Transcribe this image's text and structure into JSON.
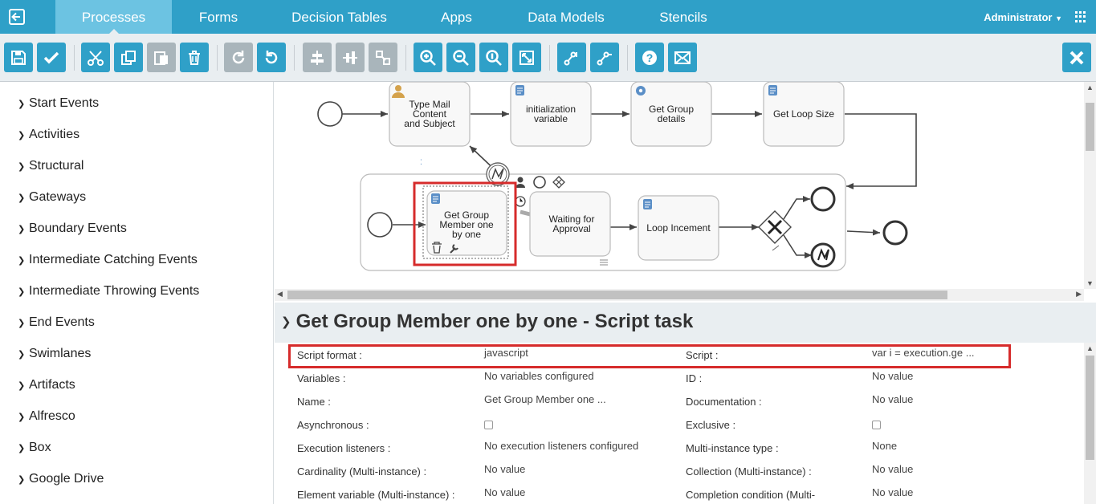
{
  "nav": {
    "tabs": [
      "Processes",
      "Forms",
      "Decision Tables",
      "Apps",
      "Data Models",
      "Stencils"
    ],
    "user": "Administrator"
  },
  "toolbar": {
    "icons": [
      "save-icon",
      "check-icon",
      "cut-icon",
      "copy-icon",
      "paste-icon",
      "delete-icon",
      "redo-icon",
      "undo-icon",
      "align-horizontal-icon",
      "align-vertical-icon",
      "same-size-icon",
      "zoom-in-icon",
      "zoom-out-icon",
      "zoom-actual-icon",
      "zoom-fit-icon",
      "add-bendpoint-icon",
      "remove-bendpoint-icon",
      "help-icon",
      "mail-icon",
      "close-icon"
    ]
  },
  "palette": {
    "items": [
      "Start Events",
      "Activities",
      "Structural",
      "Gateways",
      "Boundary Events",
      "Intermediate Catching Events",
      "Intermediate Throwing Events",
      "End Events",
      "Swimlanes",
      "Artifacts",
      "Alfresco",
      "Box",
      "Google Drive"
    ]
  },
  "diagram": {
    "tasks": {
      "type_mail": [
        "Type Mail",
        "Content",
        "and Subject"
      ],
      "init_var": [
        "initialization",
        "variable"
      ],
      "group_details": [
        "Get Group",
        "details"
      ],
      "loop_size": [
        "Get Loop Size"
      ],
      "group_member": [
        "Get Group",
        "Member one",
        "by one"
      ],
      "waiting": [
        "Waiting for",
        "Approval"
      ],
      "loop_increment": [
        "Loop Incement"
      ]
    }
  },
  "properties": {
    "title": "Get Group Member one by one - Script task",
    "rows": [
      {
        "l1": "Script format :",
        "v1": "javascript",
        "l2": "Script :",
        "v2": "var i = execution.ge ..."
      },
      {
        "l1": "Variables :",
        "v1": "No variables configured",
        "l2": "ID :",
        "v2": "No value"
      },
      {
        "l1": "Name :",
        "v1": "Get Group Member one ...",
        "l2": "Documentation :",
        "v2": "No value"
      },
      {
        "l1": "Asynchronous :",
        "v1": "",
        "l2": "Exclusive :",
        "v2": ""
      },
      {
        "l1": "Execution listeners :",
        "v1": "No execution listeners configured",
        "l2": "Multi-instance type :",
        "v2": "None"
      },
      {
        "l1": "Cardinality (Multi-instance) :",
        "v1": "No value",
        "l2": "Collection (Multi-instance) :",
        "v2": "No value"
      },
      {
        "l1": "Element variable (Multi-instance) :",
        "v1": "No value",
        "l2": "Completion condition (Multi-",
        "v2": "No value"
      }
    ]
  },
  "colors": {
    "accent": "#2fa0c8",
    "active_tab": "#6cc3e2",
    "highlight": "#d62b2b",
    "panel": "#e9eef1"
  }
}
